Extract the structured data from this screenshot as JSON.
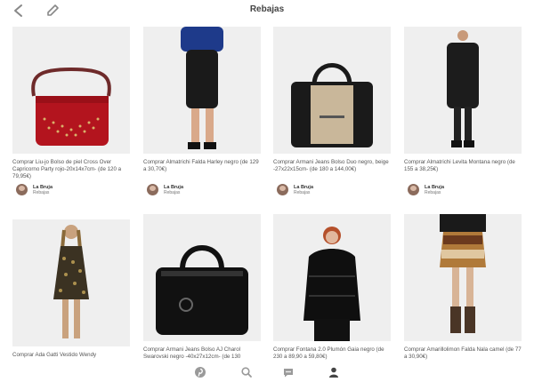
{
  "header": {
    "title": "Rebajas"
  },
  "pins": [
    {
      "description": "Comprar Liu-jo Bolso de piel Cross Over Capricorno Party rojo-20x14x7cm- (de 120 a 79,95€)",
      "user": "La Bruja",
      "board": "Rebajas"
    },
    {
      "description": "Comprar Almatrichi Falda Harley negro (de 129 a 30,70€)",
      "user": "La Bruja",
      "board": "Rebajas"
    },
    {
      "description": "Comprar Armani Jeans Bolso Duo negro, beige -27x22x15cm- (de 180 a 144,00€)",
      "user": "La Bruja",
      "board": "Rebajas"
    },
    {
      "description": "Comprar Almatrichi Levita Montana negro (de 155 a 38,25€)",
      "user": "La Bruja",
      "board": "Rebajas"
    },
    {
      "description": "Comprar Ada Gatti Vestido Wendy",
      "user": "",
      "board": ""
    },
    {
      "description": "Comprar Armani Jeans Bolso AJ Charol Swarovski negro -40x27x12cm- (de 130",
      "user": "",
      "board": ""
    },
    {
      "description": "Comprar Fontana 2.0 Plumón Gaia negro (de 230 a 89,90 a 59,80€)",
      "user": "",
      "board": ""
    },
    {
      "description": "Comprar Amarillolimon Falda Nala camel (de 77 a 30,90€)",
      "user": "",
      "board": ""
    }
  ],
  "tabs": [
    {
      "icon": "pinterest-icon"
    },
    {
      "icon": "search-icon"
    },
    {
      "icon": "chat-icon"
    },
    {
      "icon": "profile-icon"
    }
  ]
}
